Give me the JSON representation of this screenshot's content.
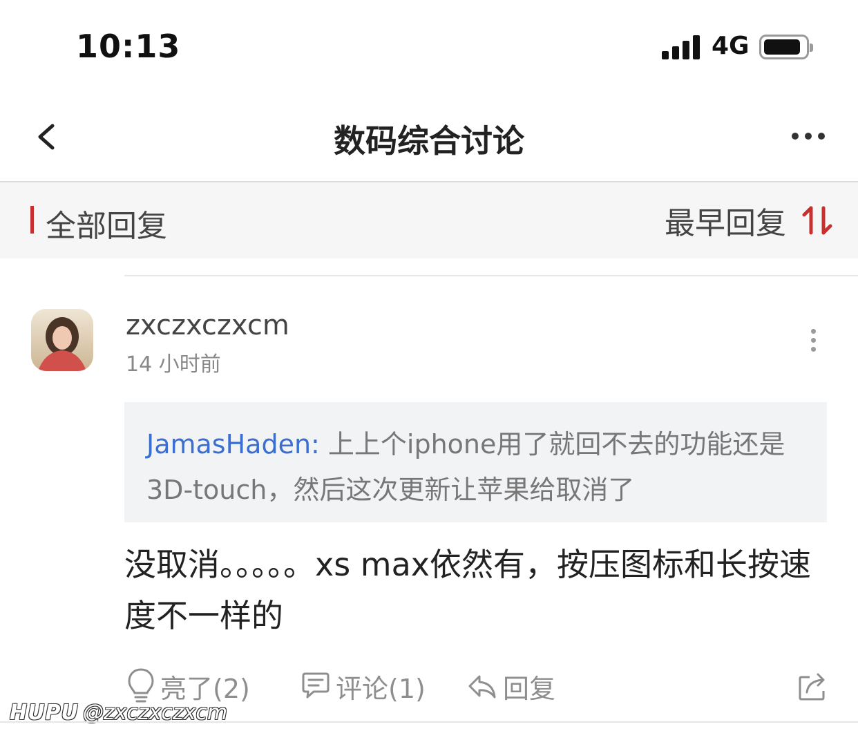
{
  "status_bar": {
    "time": "10:13",
    "network": "4G"
  },
  "nav": {
    "title": "数码综合讨论"
  },
  "section": {
    "title": "全部回复",
    "sort_label": "最早回复"
  },
  "post": {
    "username": "zxczxczxcm",
    "time": "14 小时前",
    "quote": {
      "author": "JamasHaden:",
      "text": " 上上个iphone用了就回不去的功能还是 3D-touch，然后这次更新让苹果给取消了"
    },
    "body": "没取消。。。。。xs max依然有，按压图标和长按速度不一样的",
    "actions": {
      "light_label": "亮了(2)",
      "comment_label": "评论(1)",
      "reply_label": "回复"
    }
  },
  "watermark": {
    "brand": "HUPU",
    "handle": "@zxczxczxcm"
  },
  "colors": {
    "accent": "#c8302f",
    "link": "#3a6fd1",
    "muted": "#8e8e8e"
  },
  "icons": [
    "back-icon",
    "more-icon",
    "sort-icon",
    "kebab-icon",
    "lightbulb-icon",
    "comment-icon",
    "reply-icon",
    "share-icon"
  ]
}
